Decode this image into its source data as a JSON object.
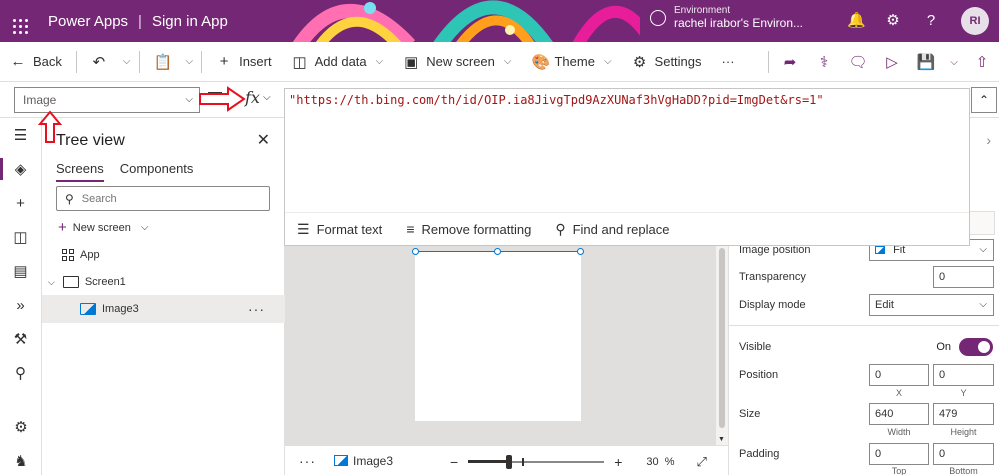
{
  "header": {
    "app_name": "Power Apps",
    "separator": "|",
    "app_subtitle": "Sign in App",
    "environment_label": "Environment",
    "environment_name": "rachel irabor's Environ...",
    "avatar_initials": "RI",
    "help_glyph": "?"
  },
  "commandbar": {
    "back": "Back",
    "insert": "Insert",
    "add_data": "Add data",
    "new_screen": "New screen",
    "theme": "Theme",
    "settings": "Settings",
    "more": "···"
  },
  "formula": {
    "property": "Image",
    "fx": "fx",
    "value": "\"https://th.bing.com/th/id/OIP.ia8JivgTpd9AzXUNaf3hVgHaDD?pid=ImgDet&rs=1\"",
    "tools": {
      "format_text": "Format text",
      "remove_formatting": "Remove formatting",
      "find_replace": "Find and replace"
    }
  },
  "tree": {
    "title": "Tree view",
    "tabs": [
      "Screens",
      "Components"
    ],
    "search_placeholder": "Search",
    "new_screen": "New screen",
    "items": [
      {
        "label": "App"
      },
      {
        "label": "Screen1"
      },
      {
        "label": "Image3"
      }
    ],
    "more": "···"
  },
  "statusbar": {
    "dots": "···",
    "selected": "Image3",
    "zoom_percent": "30",
    "percent_sign": "%",
    "zoom_level": 0.3
  },
  "properties": {
    "image_position": {
      "label": "Image position",
      "value": "Fit"
    },
    "transparency": {
      "label": "Transparency",
      "value": "0"
    },
    "display_mode": {
      "label": "Display mode",
      "value": "Edit"
    },
    "visible": {
      "label": "Visible",
      "value": "On"
    },
    "position": {
      "label": "Position",
      "x": "0",
      "y": "0",
      "x_label": "X",
      "y_label": "Y"
    },
    "size": {
      "label": "Size",
      "width": "640",
      "height": "479",
      "width_label": "Width",
      "height_label": "Height"
    },
    "padding": {
      "label": "Padding",
      "top": "0",
      "bottom": "0",
      "top_label": "Top",
      "bottom_label": "Bottom"
    }
  },
  "colors": {
    "brand": "#742774",
    "selection": "#0078d4",
    "annotation": "#e8101e",
    "formula_string": "#a31515"
  }
}
